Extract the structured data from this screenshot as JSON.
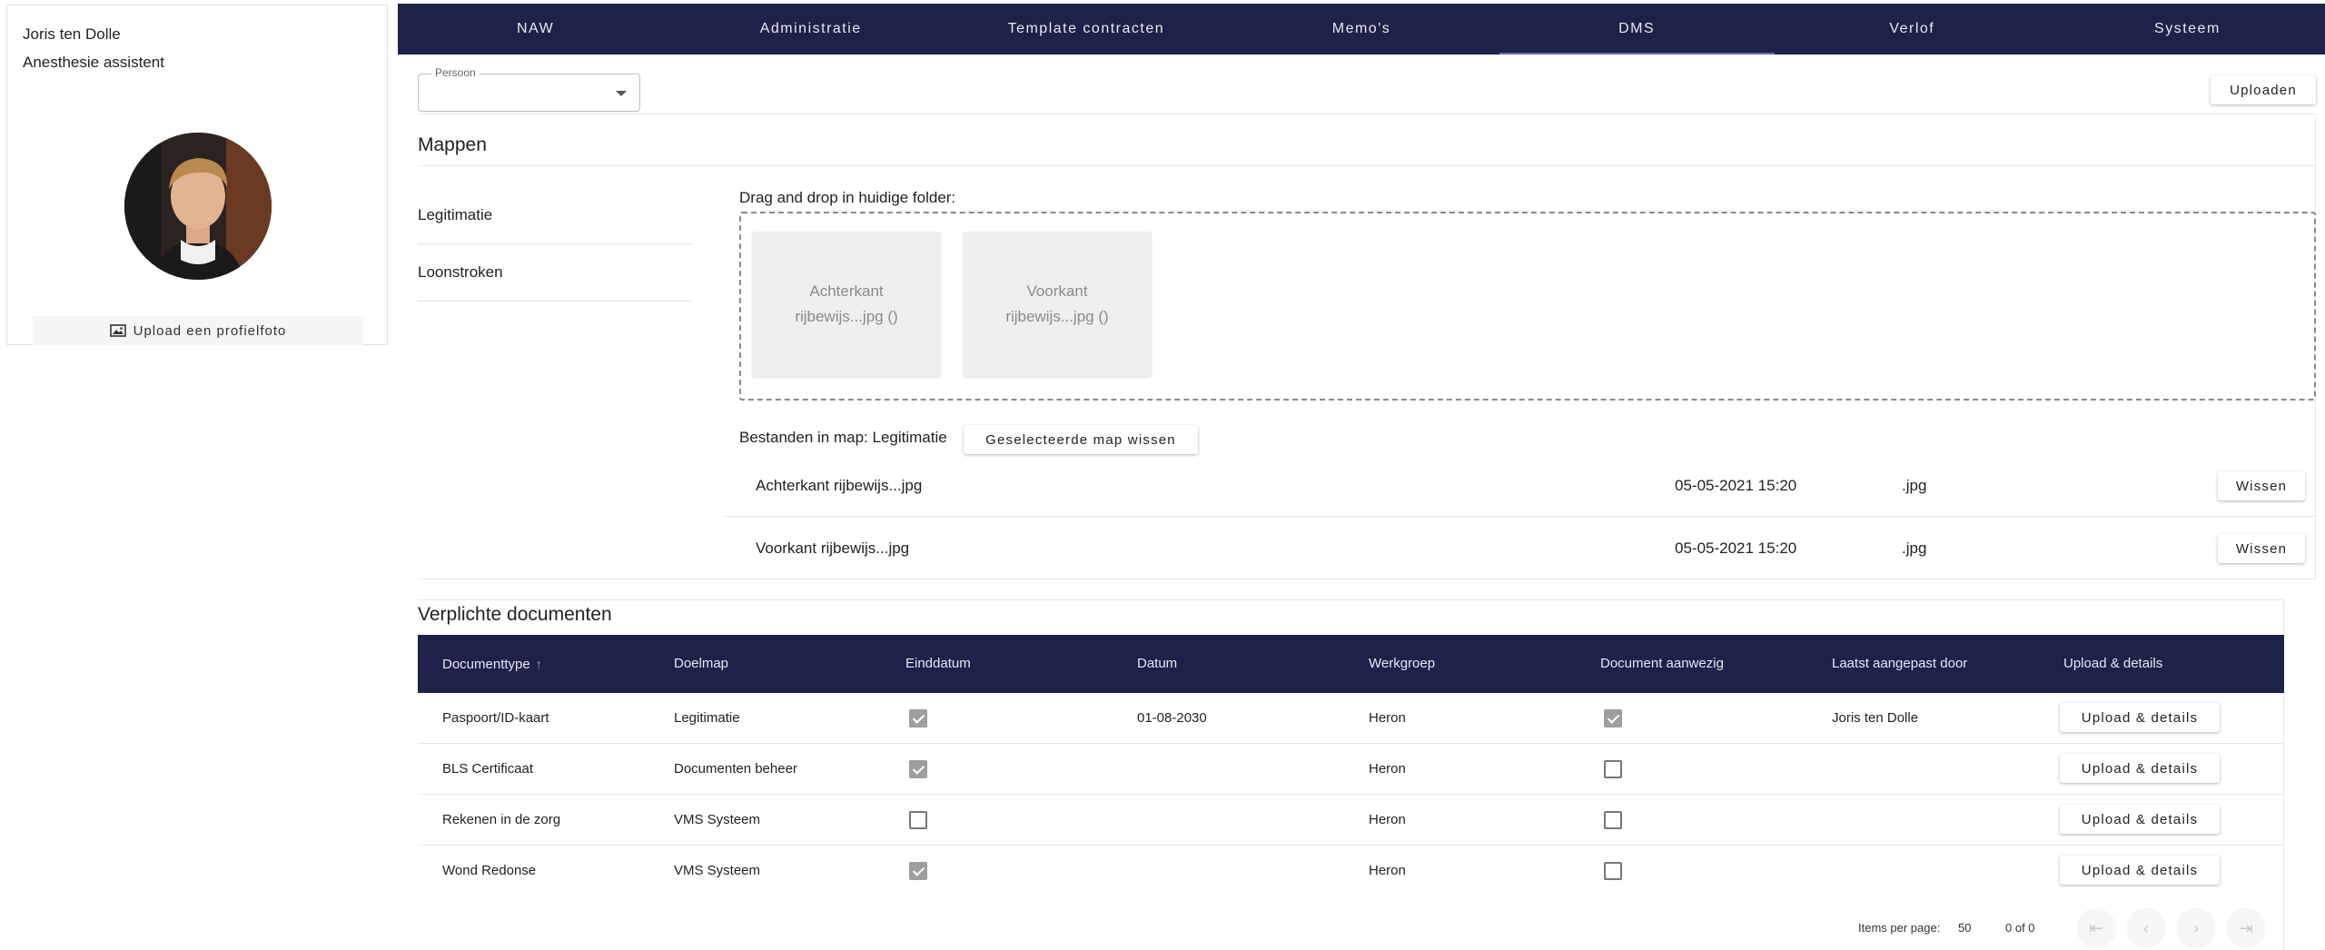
{
  "profile": {
    "name": "Joris ten Dolle",
    "role": "Anesthesie assistent",
    "upload_photo_label": "Upload een profielfoto"
  },
  "nav": {
    "tabs": [
      {
        "label": "NAW"
      },
      {
        "label": "Administratie"
      },
      {
        "label": "Template contracten"
      },
      {
        "label": "Memo's"
      },
      {
        "label": "DMS",
        "active": true
      },
      {
        "label": "Verlof"
      },
      {
        "label": "Systeem"
      }
    ]
  },
  "person_select": {
    "label": "Persoon",
    "value": ""
  },
  "upload_button_label": "Uploaden",
  "mappen": {
    "title": "Mappen",
    "folders": [
      "Legitimatie",
      "Loonstroken"
    ],
    "dropzone_label": "Drag and drop in huidige folder:",
    "tiles": [
      {
        "line1": "Achterkant",
        "line2": "rijbewijs...jpg ()"
      },
      {
        "line1": "Voorkant",
        "line2": "rijbewijs...jpg ()"
      }
    ],
    "files_in_folder_label": "Bestanden in map: Legitimatie",
    "clear_folder_label": "Geselecteerde map wissen",
    "files": [
      {
        "name": "Achterkant rijbewijs...jpg",
        "date": "05-05-2021 15:20",
        "ext": ".jpg",
        "delete_label": "Wissen"
      },
      {
        "name": "Voorkant rijbewijs...jpg",
        "date": "05-05-2021 15:20",
        "ext": ".jpg",
        "delete_label": "Wissen"
      }
    ]
  },
  "verplicht": {
    "title": "Verplichte documenten",
    "columns": [
      "Documenttype",
      "Doelmap",
      "Einddatum",
      "Datum",
      "Werkgroep",
      "Document aanwezig",
      "Laatst aangepast door",
      "Upload & details"
    ],
    "sort_arrow": "↑",
    "rows": [
      {
        "type": "Paspoort/ID-kaart",
        "doelmap": "Legitimatie",
        "einddatum": true,
        "datum": "01-08-2030",
        "werkgroep": "Heron",
        "aanwezig": true,
        "door": "Joris ten Dolle",
        "action": "Upload & details"
      },
      {
        "type": "BLS Certificaat",
        "doelmap": "Documenten beheer",
        "einddatum": true,
        "datum": "",
        "werkgroep": "Heron",
        "aanwezig": false,
        "door": "",
        "action": "Upload & details"
      },
      {
        "type": "Rekenen in de zorg",
        "doelmap": "VMS Systeem",
        "einddatum": false,
        "datum": "",
        "werkgroep": "Heron",
        "aanwezig": false,
        "door": "",
        "action": "Upload & details"
      },
      {
        "type": "Wond Redonse",
        "doelmap": "VMS Systeem",
        "einddatum": true,
        "datum": "",
        "werkgroep": "Heron",
        "aanwezig": false,
        "door": "",
        "action": "Upload & details"
      }
    ],
    "paginator": {
      "items_per_page_label": "Items per page:",
      "items_per_page": "50",
      "range": "0 of 0"
    }
  },
  "colors": {
    "nav_bg": "#1e2248",
    "active_tab_indicator": "#5b68c9",
    "checkbox_checked": "#9e9e9e"
  }
}
